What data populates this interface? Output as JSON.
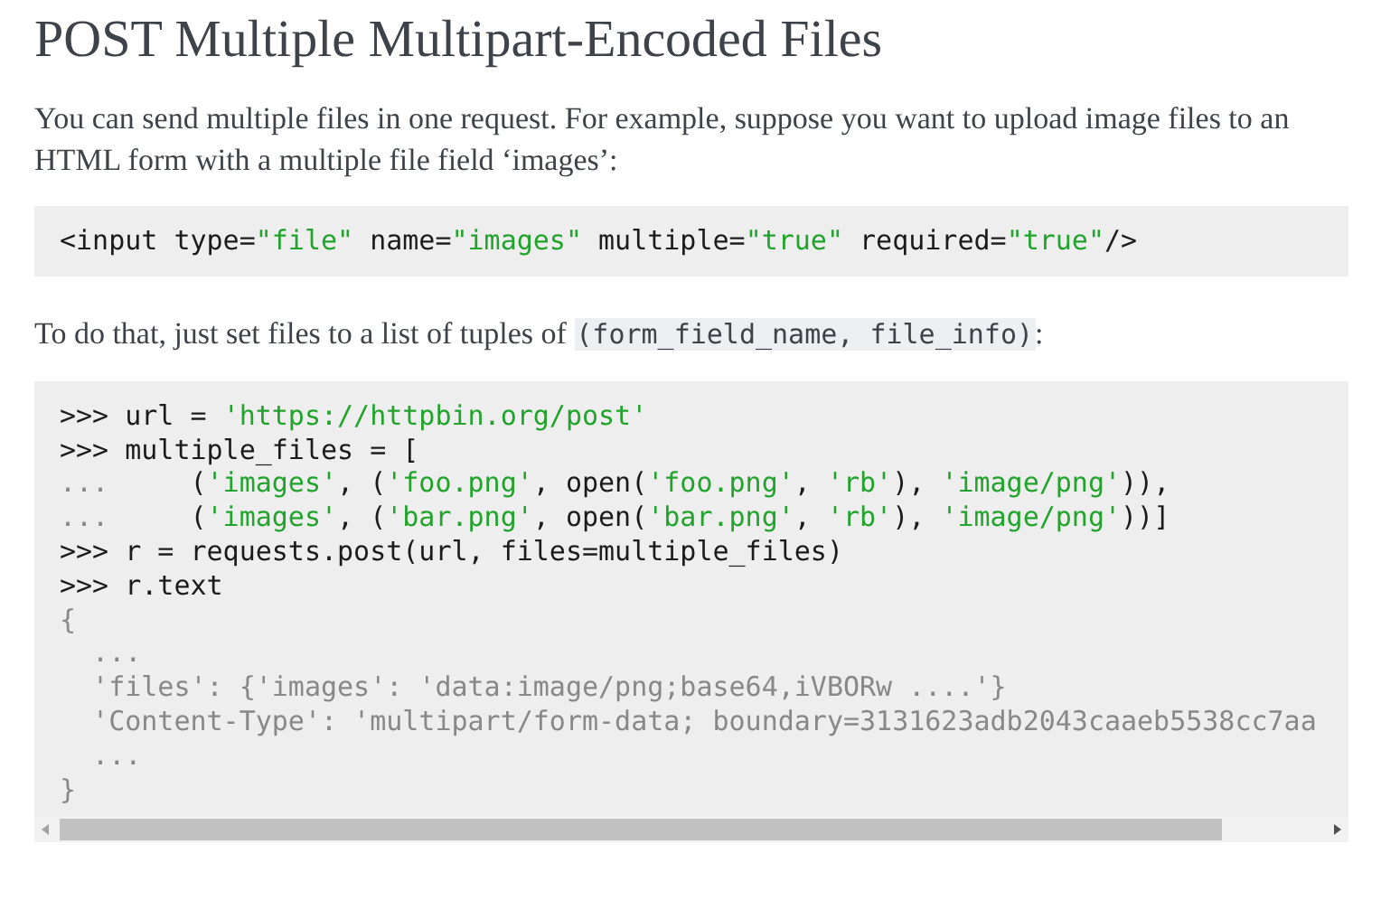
{
  "title": "POST Multiple Multipart-Encoded Files",
  "intro": "You can send multiple files in one request. For example, suppose you want to upload image files to an HTML form with a multiple file field ‘images’:",
  "html_example": [
    [
      {
        "kind": "plain",
        "text": "<input type="
      },
      {
        "kind": "string",
        "text": "\"file\""
      },
      {
        "kind": "plain",
        "text": " name="
      },
      {
        "kind": "string",
        "text": "\"images\""
      },
      {
        "kind": "plain",
        "text": " multiple="
      },
      {
        "kind": "string",
        "text": "\"true\""
      },
      {
        "kind": "plain",
        "text": " required="
      },
      {
        "kind": "string",
        "text": "\"true\""
      },
      {
        "kind": "plain",
        "text": "/>"
      }
    ]
  ],
  "explanation": {
    "before": "To do that, just set files to a list of tuples of ",
    "code": "(form_field_name, file_info)",
    "after": ":"
  },
  "python_example": [
    [
      {
        "kind": "plain",
        "text": ">>> url = "
      },
      {
        "kind": "string",
        "text": "'https://httpbin.org/post'"
      }
    ],
    [
      {
        "kind": "plain",
        "text": ">>> multiple_files = ["
      }
    ],
    [
      {
        "kind": "output",
        "text": "...     "
      },
      {
        "kind": "plain",
        "text": "("
      },
      {
        "kind": "string",
        "text": "'images'"
      },
      {
        "kind": "plain",
        "text": ", ("
      },
      {
        "kind": "string",
        "text": "'foo.png'"
      },
      {
        "kind": "plain",
        "text": ", open("
      },
      {
        "kind": "string",
        "text": "'foo.png'"
      },
      {
        "kind": "plain",
        "text": ", "
      },
      {
        "kind": "string",
        "text": "'rb'"
      },
      {
        "kind": "plain",
        "text": "), "
      },
      {
        "kind": "string",
        "text": "'image/png'"
      },
      {
        "kind": "plain",
        "text": ")),"
      }
    ],
    [
      {
        "kind": "output",
        "text": "...     "
      },
      {
        "kind": "plain",
        "text": "("
      },
      {
        "kind": "string",
        "text": "'images'"
      },
      {
        "kind": "plain",
        "text": ", ("
      },
      {
        "kind": "string",
        "text": "'bar.png'"
      },
      {
        "kind": "plain",
        "text": ", open("
      },
      {
        "kind": "string",
        "text": "'bar.png'"
      },
      {
        "kind": "plain",
        "text": ", "
      },
      {
        "kind": "string",
        "text": "'rb'"
      },
      {
        "kind": "plain",
        "text": "), "
      },
      {
        "kind": "string",
        "text": "'image/png'"
      },
      {
        "kind": "plain",
        "text": "))]"
      }
    ],
    [
      {
        "kind": "plain",
        "text": ">>> r = requests.post(url, files=multiple_files)"
      }
    ],
    [
      {
        "kind": "plain",
        "text": ">>> r.text"
      }
    ],
    [
      {
        "kind": "output",
        "text": "{"
      }
    ],
    [
      {
        "kind": "output",
        "text": "  ..."
      }
    ],
    [
      {
        "kind": "output",
        "text": "  'files': {'images': 'data:image/png;base64,iVBORw ....'}"
      }
    ],
    [
      {
        "kind": "output",
        "text": "  'Content-Type': 'multipart/form-data; boundary=3131623adb2043caaeb5538cc7aa"
      }
    ],
    [
      {
        "kind": "output",
        "text": "  ..."
      }
    ],
    [
      {
        "kind": "output",
        "text": "}"
      }
    ]
  ]
}
